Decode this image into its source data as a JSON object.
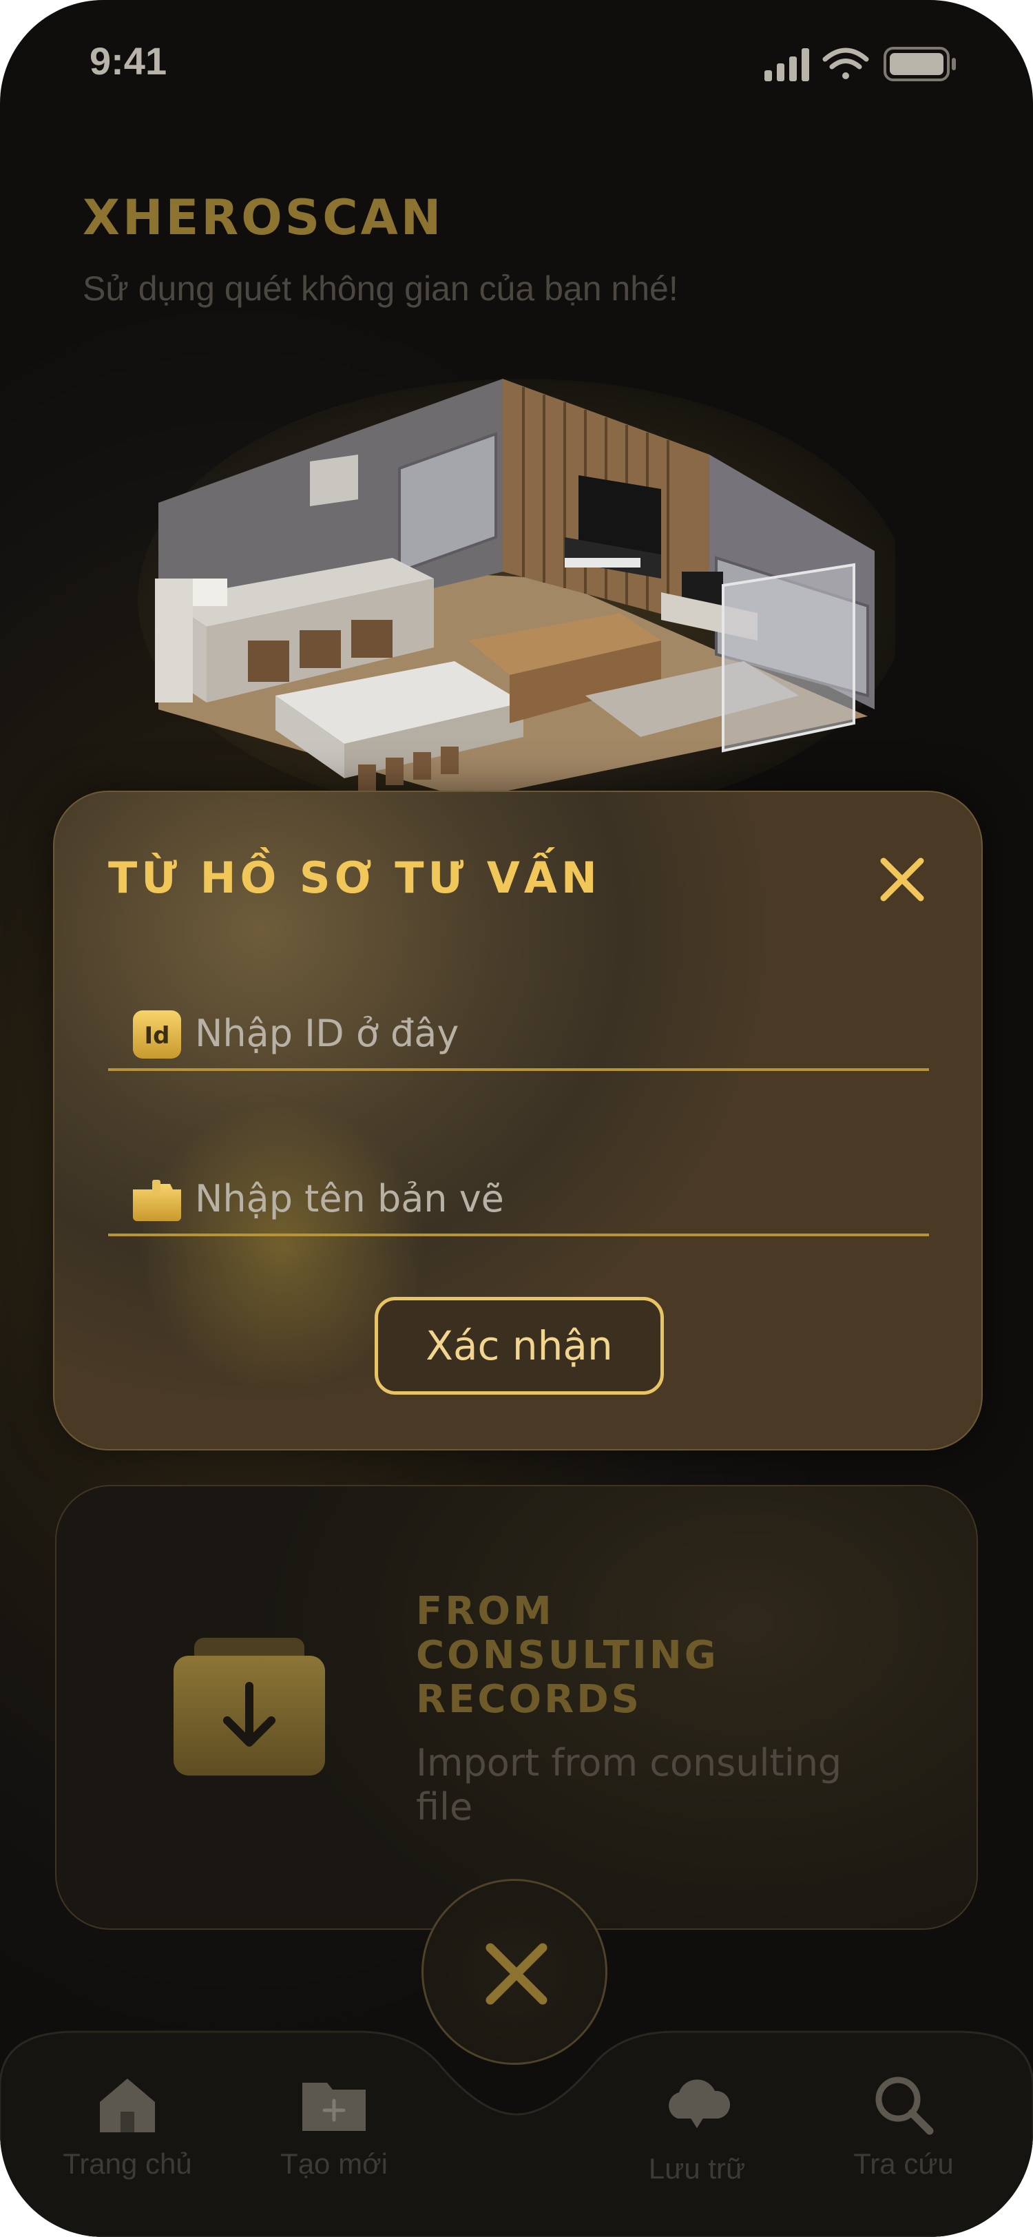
{
  "status_bar": {
    "time": "9:41"
  },
  "app": {
    "title": "XHEROSCAN",
    "subtitle": "Sử dụng quét không gian của bạn nhé!"
  },
  "dialog": {
    "title": "TỪ HỒ SƠ TƯ VẤN",
    "id_icon_text": "Id",
    "id_placeholder": "Nhập ID ở đây",
    "name_placeholder": "Nhập tên bản vẽ",
    "confirm_label": "Xác nhận"
  },
  "card": {
    "title_lines": [
      "FROM",
      "CONSULTING",
      "RECORDS"
    ],
    "description": "Import from consulting file"
  },
  "tabbar": {
    "tabs": [
      {
        "label": "Trang chủ",
        "icon": "home-icon"
      },
      {
        "label": "Tạo mới",
        "icon": "new-folder-icon"
      },
      {
        "label": "Lưu trữ",
        "icon": "cloud-download-icon"
      },
      {
        "label": "Tra cứu",
        "icon": "search-icon"
      }
    ]
  },
  "colors": {
    "gold": "#f2c75a",
    "gold_dark": "#8c7330",
    "background": "#141210"
  }
}
